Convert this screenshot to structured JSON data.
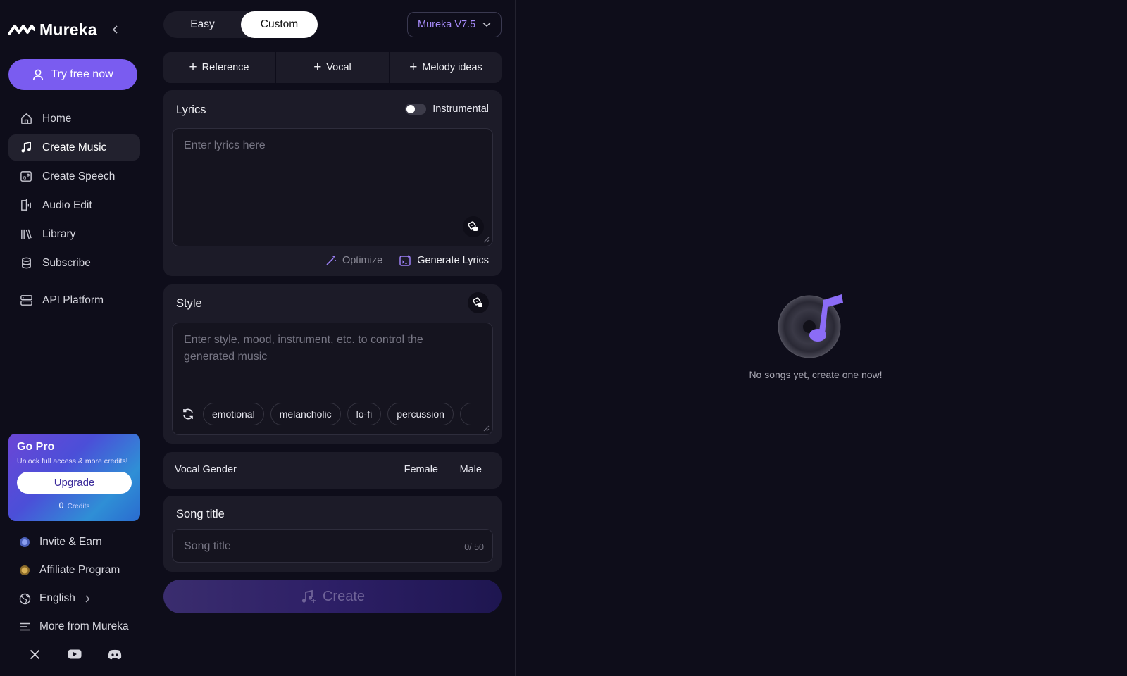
{
  "brand": {
    "name": "Mureka"
  },
  "sidebar": {
    "try_button": "Try free now",
    "items": [
      {
        "label": "Home",
        "icon": "home-icon",
        "active": false
      },
      {
        "label": "Create Music",
        "icon": "music-note-icon",
        "active": true
      },
      {
        "label": "Create Speech",
        "icon": "speech-icon",
        "active": false
      },
      {
        "label": "Audio Edit",
        "icon": "audio-edit-icon",
        "active": false
      },
      {
        "label": "Library",
        "icon": "library-icon",
        "active": false
      },
      {
        "label": "Subscribe",
        "icon": "subscribe-icon",
        "active": false
      },
      {
        "label": "API Platform",
        "icon": "api-icon",
        "active": false
      }
    ],
    "pro": {
      "title": "Go Pro",
      "subtitle": "Unlock full access & more credits!",
      "upgrade": "Upgrade",
      "credits_value": "0",
      "credits_label": "Credits"
    },
    "bottom": [
      {
        "label": "Invite & Earn",
        "icon": "invite-icon"
      },
      {
        "label": "Affiliate Program",
        "icon": "affiliate-icon"
      },
      {
        "label": "English",
        "icon": "globe-icon"
      },
      {
        "label": "More from Mureka",
        "icon": "menu-icon"
      }
    ],
    "social": [
      "x-icon",
      "youtube-icon",
      "discord-icon"
    ]
  },
  "panel": {
    "modes": {
      "easy": "Easy",
      "custom": "Custom",
      "selected": "Custom"
    },
    "model": "Mureka V7.5",
    "adders": {
      "reference": "Reference",
      "vocal": "Vocal",
      "melody": "Melody ideas"
    },
    "lyrics": {
      "title": "Lyrics",
      "instrumental_label": "Instrumental",
      "instrumental_on": false,
      "placeholder": "Enter lyrics here",
      "optimize": "Optimize",
      "generate": "Generate Lyrics"
    },
    "style": {
      "title": "Style",
      "placeholder_line1": "Enter style, mood, instrument, etc. to control the",
      "placeholder_line2": "generated music",
      "tags": [
        "emotional",
        "melancholic",
        "lo-fi",
        "percussion"
      ]
    },
    "vocal_gender": {
      "label": "Vocal Gender",
      "female": "Female",
      "male": "Male"
    },
    "song_title": {
      "title": "Song title",
      "placeholder": "Song title",
      "counter": "0/ 50"
    },
    "create_button": "Create"
  },
  "empty_state": {
    "text": "No songs yet, create one now!"
  },
  "colors": {
    "accent": "#7a5cf0",
    "model": "#a78bfa",
    "background": "#0e0d1a",
    "card": "#1c1b28"
  }
}
